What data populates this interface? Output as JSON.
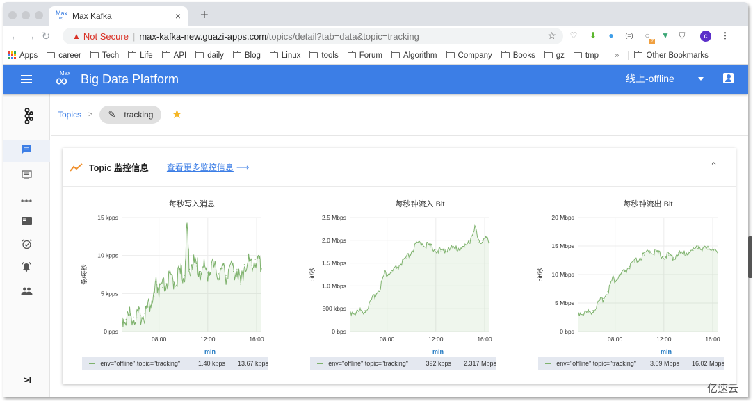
{
  "browser": {
    "tab_title": "Max Kafka",
    "tab_close": "×",
    "new_tab": "+",
    "not_secure": "Not Secure",
    "url_host": "max-kafka-new.guazi-apps.com",
    "url_path": "/topics/detail?tab=data&topic=tracking",
    "extension_badge": "7",
    "profile_initial": "c",
    "bookmarks": [
      "career",
      "Tech",
      "Life",
      "API",
      "daily",
      "Blog",
      "Linux",
      "tools",
      "Forum",
      "Algorithm",
      "Company",
      "Books",
      "gz",
      "tmp"
    ],
    "apps_label": "Apps",
    "overflow": "»",
    "other_bookmarks": "Other Bookmarks"
  },
  "app": {
    "logo_small": "Max",
    "title": "Big Data Platform",
    "env_selected": "线上-offline"
  },
  "sidebar": {
    "items": [
      "topics",
      "consumers",
      "connectors",
      "dashboard",
      "schedules",
      "alerts",
      "users"
    ],
    "active": "topics",
    "collapse": ">I"
  },
  "breadcrumb": {
    "root": "Topics",
    "separator": ">",
    "current": "tracking"
  },
  "card": {
    "title": "Topic 监控信息",
    "link": "查看更多监控信息",
    "link_arrow": "⟶"
  },
  "chart_data": [
    {
      "type": "area",
      "title": "每秒写入消息",
      "ylabel": "条/每秒",
      "xlabel": "",
      "x_ticks": [
        "08:00",
        "12:00",
        "16:00"
      ],
      "y_ticks": [
        "0 pps",
        "5 kpps",
        "10 kpps",
        "15 kpps"
      ],
      "ylim": [
        0,
        15000
      ],
      "x_range_hours": [
        5.0,
        16.4
      ],
      "grid": true,
      "series": [
        {
          "name": "env=\"offline\",topic=\"tracking\"",
          "color": "#7eb26d",
          "min": "1.40 kpps",
          "max": "13.67 kpps",
          "points": [
            [
              5.0,
              1800
            ],
            [
              5.3,
              1600
            ],
            [
              5.6,
              2200
            ],
            [
              5.9,
              1900
            ],
            [
              6.2,
              1800
            ],
            [
              6.5,
              2100
            ],
            [
              6.8,
              2400
            ],
            [
              7.1,
              3200
            ],
            [
              7.4,
              4000
            ],
            [
              7.6,
              4600
            ],
            [
              7.8,
              6500
            ],
            [
              8.0,
              5200
            ],
            [
              8.3,
              5800
            ],
            [
              8.6,
              6300
            ],
            [
              8.9,
              6900
            ],
            [
              9.2,
              6600
            ],
            [
              9.5,
              7200
            ],
            [
              9.8,
              7600
            ],
            [
              10.1,
              7400
            ],
            [
              10.3,
              13670
            ],
            [
              10.5,
              8200
            ],
            [
              10.8,
              9200
            ],
            [
              11.1,
              8600
            ],
            [
              11.4,
              7900
            ],
            [
              11.7,
              8400
            ],
            [
              12.0,
              7700
            ],
            [
              12.3,
              8800
            ],
            [
              12.6,
              8100
            ],
            [
              12.9,
              7600
            ],
            [
              13.2,
              8300
            ],
            [
              13.5,
              7400
            ],
            [
              13.8,
              8600
            ],
            [
              14.1,
              7900
            ],
            [
              14.4,
              8200
            ],
            [
              14.7,
              6200
            ],
            [
              15.0,
              8800
            ],
            [
              15.3,
              9200
            ],
            [
              15.6,
              8700
            ],
            [
              15.9,
              9500
            ],
            [
              16.2,
              9200
            ],
            [
              16.4,
              8300
            ]
          ]
        }
      ]
    },
    {
      "type": "area",
      "title": "每秒钟流入 Bit",
      "ylabel": "bit/秒",
      "xlabel": "",
      "x_ticks": [
        "08:00",
        "12:00",
        "16:00"
      ],
      "y_ticks": [
        "0 bps",
        "500 kbps",
        "1.0 Mbps",
        "1.5 Mbps",
        "2.0 Mbps",
        "2.5 Mbps"
      ],
      "ylim": [
        0,
        2500000
      ],
      "x_range_hours": [
        5.0,
        16.4
      ],
      "grid": true,
      "series": [
        {
          "name": "env=\"offline\",topic=\"tracking\"",
          "color": "#7eb26d",
          "min": "392 kbps",
          "max": "2.317 Mbps",
          "points": [
            [
              5.0,
              430000
            ],
            [
              5.4,
              410000
            ],
            [
              5.8,
              450000
            ],
            [
              6.2,
              460000
            ],
            [
              6.6,
              600000
            ],
            [
              7.0,
              800000
            ],
            [
              7.4,
              950000
            ],
            [
              7.8,
              1280000
            ],
            [
              8.1,
              1260000
            ],
            [
              8.4,
              1300000
            ],
            [
              8.8,
              1400000
            ],
            [
              9.2,
              1500000
            ],
            [
              9.6,
              1600000
            ],
            [
              10.0,
              1750000
            ],
            [
              10.4,
              1900000
            ],
            [
              10.8,
              1950000
            ],
            [
              11.2,
              1900000
            ],
            [
              11.6,
              1850000
            ],
            [
              12.0,
              1800000
            ],
            [
              12.4,
              1750000
            ],
            [
              12.8,
              1800000
            ],
            [
              13.2,
              1850000
            ],
            [
              13.6,
              1800000
            ],
            [
              14.0,
              1850000
            ],
            [
              14.4,
              1850000
            ],
            [
              14.8,
              2000000
            ],
            [
              15.2,
              2317000
            ],
            [
              15.5,
              1950000
            ],
            [
              15.8,
              2000000
            ],
            [
              16.1,
              2050000
            ],
            [
              16.4,
              1950000
            ]
          ]
        }
      ]
    },
    {
      "type": "area",
      "title": "每秒钟流出 Bit",
      "ylabel": "bit/秒",
      "xlabel": "",
      "x_ticks": [
        "08:00",
        "12:00",
        "16:00"
      ],
      "y_ticks": [
        "0 bps",
        "5 Mbps",
        "10 Mbps",
        "15 Mbps",
        "20 Mbps"
      ],
      "ylim": [
        0,
        20000000
      ],
      "x_range_hours": [
        5.0,
        16.4
      ],
      "grid": true,
      "series": [
        {
          "name": "env=\"offline\",topic=\"tracking\"",
          "color": "#7eb26d",
          "min": "3.09 Mbps",
          "max": "16.02 Mbps",
          "points": [
            [
              5.0,
              3300000
            ],
            [
              5.4,
              3200000
            ],
            [
              5.8,
              3400000
            ],
            [
              6.2,
              3700000
            ],
            [
              6.6,
              4800000
            ],
            [
              7.0,
              5800000
            ],
            [
              7.4,
              7000000
            ],
            [
              7.8,
              9300000
            ],
            [
              8.1,
              9000000
            ],
            [
              8.4,
              9800000
            ],
            [
              8.8,
              10600000
            ],
            [
              9.2,
              11400000
            ],
            [
              9.6,
              12200000
            ],
            [
              10.0,
              12800000
            ],
            [
              10.4,
              13400000
            ],
            [
              10.8,
              14200000
            ],
            [
              11.2,
              14000000
            ],
            [
              11.6,
              13600000
            ],
            [
              12.0,
              13200000
            ],
            [
              12.4,
              13400000
            ],
            [
              12.8,
              13000000
            ],
            [
              13.2,
              13800000
            ],
            [
              13.6,
              13500000
            ],
            [
              14.0,
              14000000
            ],
            [
              14.4,
              14200000
            ],
            [
              14.8,
              15000000
            ],
            [
              15.2,
              14600000
            ],
            [
              15.6,
              14400000
            ],
            [
              16.0,
              14800000
            ],
            [
              16.4,
              13800000
            ]
          ]
        }
      ]
    }
  ],
  "watermark": "亿速云"
}
